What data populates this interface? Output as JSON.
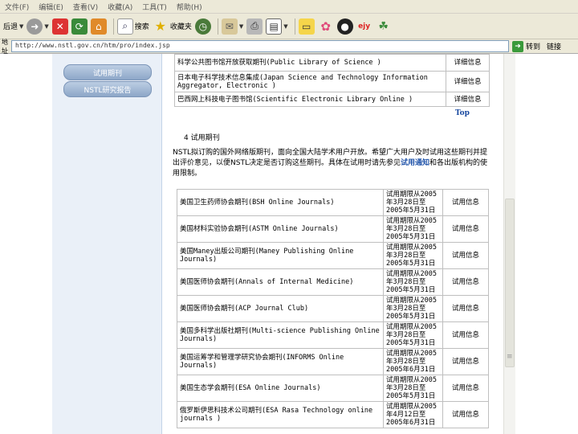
{
  "menu": [
    "文件(F)",
    "编辑(E)",
    "查看(V)",
    "收藏(A)",
    "工具(T)",
    "帮助(H)"
  ],
  "toolbar": {
    "back": "后退",
    "search": "搜索",
    "favorites": "收藏夹"
  },
  "address": {
    "label": "地址",
    "url": "http://www.nstl.gov.cn/htm/pro/index.jsp",
    "go": "转到",
    "links": "链接"
  },
  "sidebar": {
    "btn1": "试用期刊",
    "btn2": "NSTL研究报告"
  },
  "db_table": [
    {
      "name": "科学公共图书馆开放获取期刊(Public Library of Science )",
      "link": "详细信息"
    },
    {
      "name": "日本电子科学技术信息集成(Japan Science and Technology Information Aggregator, Electronic )",
      "link": "详细信息"
    },
    {
      "name": "巴西网上科技电子图书馆(Scientific Electronic Library Online )",
      "link": "详细信息"
    }
  ],
  "top_link": "Top",
  "section": {
    "title": "4  试用期刊",
    "para_before": "NSTL拟订购的国外网络版期刊，面向全国大陆学术用户开放。希望广大用户及时试用这些期刊并提出评价意见，以便NSTL决定是否订购这些期刊。具体在试用时请先参见",
    "para_link": "试用通知",
    "para_after": "和各出版机构的使用限制。"
  },
  "journals": [
    {
      "name": "美国卫生药师协会期刊(BSH Online Journals)",
      "period": "试用期限从2005年3月28日至2005年5月31日",
      "link": "试用信息"
    },
    {
      "name": "美国材料实验协会期刊(ASTM Online Journals)",
      "period": "试用期限从2005年3月28日至2005年5月31日",
      "link": "试用信息"
    },
    {
      "name": "美国Maney出版公司期刊(Maney Publishing Online Journals)",
      "period": "试用期限从2005年3月28日至2005年5月31日",
      "link": "试用信息"
    },
    {
      "name": "美国医师协会期刊(Annals of Internal Medicine)",
      "period": "试用期限从2005年3月28日至2005年5月31日",
      "link": "试用信息"
    },
    {
      "name": "美国医师协会期刊(ACP Journal Club)",
      "period": "试用期限从2005年3月28日至2005年5月31日",
      "link": "试用信息"
    },
    {
      "name": "美国多科学出版社期刊(Multi-science Publishing Online Journals)",
      "period": "试用期限从2005年3月28日至2005年5月31日",
      "link": "试用信息"
    },
    {
      "name": "美国运筹学和管理学研究协会期刊(INFORMS Online Journals)",
      "period": "试用期限从2005年3月28日至2005年6月31日",
      "link": "试用信息"
    },
    {
      "name": "美国生态学会期刊(ESA Online Journals)",
      "period": "试用期限从2005年3月28日至2005年5月31日",
      "link": "试用信息"
    },
    {
      "name": "俄罗斯伊思科技术公司期刊(ESA Rasa Technology online journals )",
      "period": "试用期限从2005年4月12日至2005年6月31日",
      "link": "试用信息"
    }
  ]
}
